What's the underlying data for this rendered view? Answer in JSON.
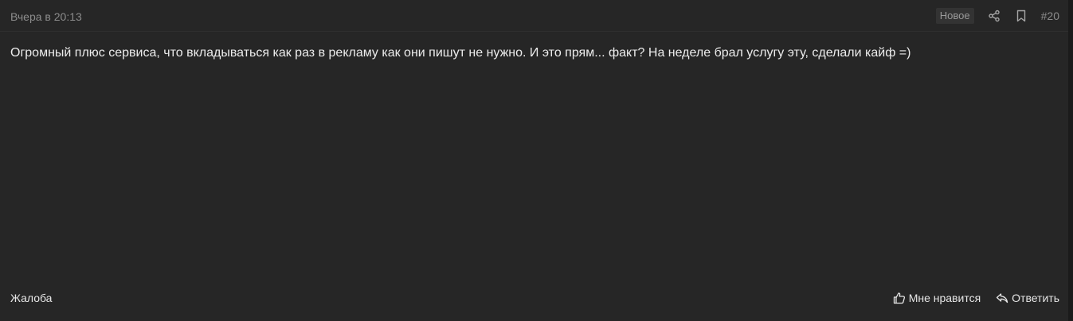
{
  "post": {
    "date": "Вчера в 20:13",
    "badge": "Новое",
    "number": "#20",
    "text": "Огромный плюс сервиса, что вкладываться как раз в рекламу как они пишут не нужно. И это прям... факт? На неделе брал услугу эту, сделали кайф =)",
    "icons": {
      "share": "share-icon",
      "bookmark": "bookmark-icon",
      "like": "thumbs-up-icon",
      "reply": "reply-arrow-icon"
    }
  },
  "footer": {
    "report_label": "Жалоба",
    "like_label": "Мне нравится",
    "reply_label": "Ответить"
  },
  "colors": {
    "background": "#262626",
    "text": "#ececec",
    "muted": "#8c8c8c",
    "badge_bg": "#333333"
  }
}
